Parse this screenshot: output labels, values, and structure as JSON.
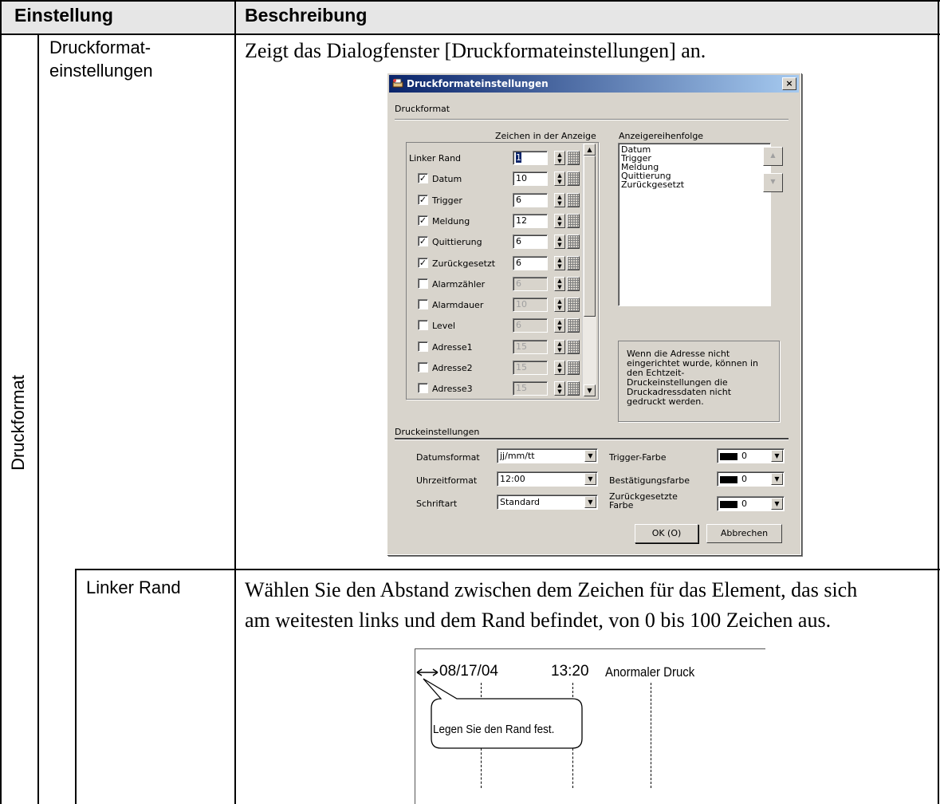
{
  "table": {
    "header_setting": "Einstellung",
    "header_description": "Beschreibung",
    "section_label": "Druckformat",
    "row1": {
      "setting": "Druckformat-\neinstellungen",
      "setting_line1": "Druckformat-",
      "setting_line2": "einstellungen",
      "description": "Zeigt das Dialogfenster [Druckformateinstellungen] an."
    },
    "row2": {
      "setting": "Linker Rand",
      "description_line1": "Wählen Sie den Abstand zwischen dem Zeichen für das Element, das sich",
      "description_line2": "am weitesten links und dem Rand befindet, von 0 bis 100 Zeichen aus."
    }
  },
  "dialog": {
    "title": "Druckformateinstellungen",
    "close_glyph": "×",
    "section_format": "Druckformat",
    "col_header_chars": "Zeichen in der Anzeige",
    "col_header_order": "Anzeigereihenfolge",
    "left_margin_label": "Linker Rand",
    "left_margin_value": "1",
    "items": [
      {
        "label": "Datum",
        "checked": true,
        "value": "10"
      },
      {
        "label": "Trigger",
        "checked": true,
        "value": "6"
      },
      {
        "label": "Meldung",
        "checked": true,
        "value": "12"
      },
      {
        "label": "Quittierung",
        "checked": true,
        "value": "6"
      },
      {
        "label": "Zurückgesetzt",
        "checked": true,
        "value": "6"
      },
      {
        "label": "Alarmzähler",
        "checked": false,
        "value": "6"
      },
      {
        "label": "Alarmdauer",
        "checked": false,
        "value": "10"
      },
      {
        "label": "Level",
        "checked": false,
        "value": "6"
      },
      {
        "label": "Adresse1",
        "checked": false,
        "value": "15"
      },
      {
        "label": "Adresse2",
        "checked": false,
        "value": "15"
      },
      {
        "label": "Adresse3",
        "checked": false,
        "value": "15"
      }
    ],
    "order_list": [
      "Datum",
      "Trigger",
      "Meldung",
      "Quittierung",
      "Zurückgesetzt"
    ],
    "note_line1": "Wenn die Adresse nicht",
    "note_line2": "eingerichtet wurde, können in",
    "note_line3": "den Echtzeit-",
    "note_line4": "Druckeinstellungen die",
    "note_line5": "Druckadressdaten nicht",
    "note_line6": "gedruckt werden.",
    "section_print": "Druckeinstellungen",
    "date_format_label": "Datumsformat",
    "date_format_value": "jj/mm/tt",
    "time_format_label": "Uhrzeitformat",
    "time_format_value": "12:00",
    "font_label": "Schriftart",
    "font_value": "Standard",
    "trigger_color_label": "Trigger-Farbe",
    "trigger_color_value": "0",
    "ack_color_label": "Bestätigungsfarbe",
    "ack_color_value": "0",
    "reset_color_label_line1": "Zurückgesetzte",
    "reset_color_label_line2": "Farbe",
    "reset_color_value": "0",
    "ok_label": "OK (O)",
    "cancel_label": "Abbrechen"
  },
  "illustration": {
    "date": "08/17/04",
    "time": "13:20",
    "message": "Anormaler Druck",
    "callout": "Legen Sie den Rand fest."
  },
  "colors": {
    "header_bg": "#e6e6e6",
    "dialog_face": "#d8d4cc",
    "titlebar_start": "#0a246a",
    "titlebar_end": "#a6caf0"
  }
}
